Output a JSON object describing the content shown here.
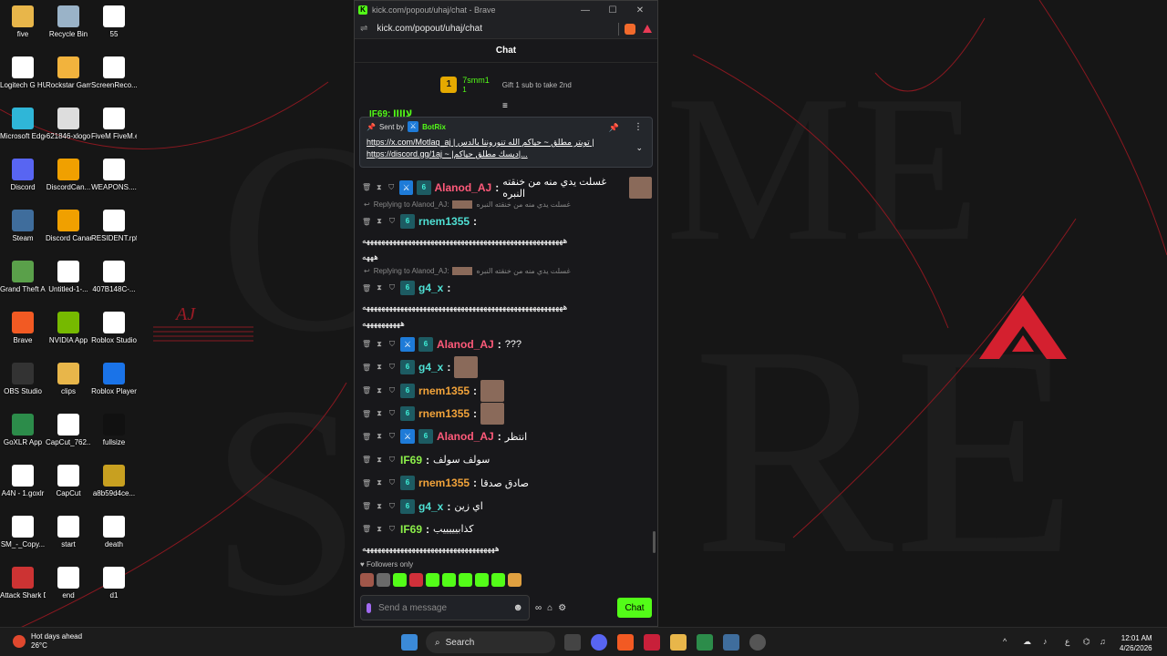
{
  "desktop": {
    "icons": [
      {
        "label": "five",
        "color": "#e8b64a",
        "glyph": "folder-icon"
      },
      {
        "label": "Recycle Bin",
        "color": "#9ab3c8",
        "glyph": "recycle-bin-icon"
      },
      {
        "label": "55",
        "color": "#ffffff",
        "glyph": "file-icon"
      },
      {
        "label": "Logitech G HUB",
        "color": "#ffffff",
        "glyph": "logitech-icon"
      },
      {
        "label": "Rockstar Games ...",
        "color": "#f2b33d",
        "glyph": "rockstar-icon"
      },
      {
        "label": "ScreenReco... ١٦-٣٥-٣٤_١",
        "color": "#ffffff",
        "glyph": "file-icon"
      },
      {
        "label": "Microsoft Edge",
        "color": "#2fb6d8",
        "glyph": "edge-icon"
      },
      {
        "label": "621846-xlogo",
        "color": "#dddddd",
        "glyph": "x-logo-icon"
      },
      {
        "label": "FiveM FiveM.exe ...",
        "color": "#ffffff",
        "glyph": "fivem-icon"
      },
      {
        "label": "Discord",
        "color": "#5865f2",
        "glyph": "discord-icon"
      },
      {
        "label": "DiscordCan...",
        "color": "#f0a000",
        "glyph": "discord-canary-icon"
      },
      {
        "label": "WEAPONS....",
        "color": "#ffffff",
        "glyph": "file-icon"
      },
      {
        "label": "Steam",
        "color": "#3f6d9c",
        "glyph": "steam-icon"
      },
      {
        "label": "Discord Canary",
        "color": "#f0a000",
        "glyph": "discord-canary-icon"
      },
      {
        "label": "RESIDENT.rpf",
        "color": "#ffffff",
        "glyph": "file-icon"
      },
      {
        "label": "Grand Theft Auto V Le...",
        "color": "#5aa04a",
        "glyph": "gta-icon"
      },
      {
        "label": "Untitled-1-...",
        "color": "#ffffff",
        "glyph": "file-icon"
      },
      {
        "label": "407B148C-...",
        "color": "#ffffff",
        "glyph": "file-icon"
      },
      {
        "label": "Brave",
        "color": "#f25a23",
        "glyph": "brave-icon"
      },
      {
        "label": "NVIDIA App",
        "color": "#76b900",
        "glyph": "nvidia-icon"
      },
      {
        "label": "Roblox Studio",
        "color": "#ffffff",
        "glyph": "roblox-studio-icon"
      },
      {
        "label": "OBS Studio",
        "color": "#333333",
        "glyph": "obs-icon"
      },
      {
        "label": "clips",
        "color": "#e8b64a",
        "glyph": "folder-icon"
      },
      {
        "label": "Roblox Player",
        "color": "#1a73e8",
        "glyph": "roblox-icon"
      },
      {
        "label": "GoXLR App",
        "color": "#2c8c4a",
        "glyph": "goxlr-icon"
      },
      {
        "label": "CapCut_762...",
        "color": "#ffffff",
        "glyph": "capcut-icon"
      },
      {
        "label": "fullsize",
        "color": "#111111",
        "glyph": "image-icon"
      },
      {
        "label": "A4N - 1.goxlr",
        "color": "#ffffff",
        "glyph": "file-icon"
      },
      {
        "label": "CapCut",
        "color": "#ffffff",
        "glyph": "capcut-icon"
      },
      {
        "label": "a8b59d4ce...",
        "color": "#c8a020",
        "glyph": "image-icon"
      },
      {
        "label": "SM_-_Copy...",
        "color": "#ffffff",
        "glyph": "file-icon"
      },
      {
        "label": "start",
        "color": "#ffffff",
        "glyph": "file-icon"
      },
      {
        "label": "death",
        "color": "#ffffff",
        "glyph": "file-icon"
      },
      {
        "label": "Attack Shark Driver v4",
        "color": "#cc3333",
        "glyph": "attack-shark-icon"
      },
      {
        "label": "end",
        "color": "#ffffff",
        "glyph": "file-icon"
      },
      {
        "label": "d1",
        "color": "#ffffff",
        "glyph": "file-icon"
      }
    ],
    "wallpaper_text": "AJ"
  },
  "browser": {
    "title": "kick.com/popout/uhaj/chat - Brave",
    "url": "kick.com/popout/uhaj/chat",
    "window_buttons": [
      "—",
      "☐",
      "✕"
    ]
  },
  "chat": {
    "header": "Chat",
    "top_gifter": {
      "rank": "1",
      "name": "7smm1",
      "count": "1",
      "info": "Gift 1 sub to take 2nd"
    },
    "partial_row": "IF69: لااااا",
    "pinned": {
      "sent_by_label": "Sent by",
      "bot": "BotRix",
      "line1": "https://x.com/Motlaq_aj | تويتر مطلق ~ حياكم الله تنوروننا بالدس |",
      "line2": "https://discord.gg/1aj ~ |ديسك مطلق حياكم|..."
    },
    "messages": [
      {
        "type": "msg",
        "user": "Alanod_AJ",
        "color": "#ff5a7a",
        "mod": true,
        "text": "غسلت يدي منه من خنقته النبره",
        "emote": true
      },
      {
        "type": "reply",
        "text": "Replying to Alanod_AJ:",
        "quote": "غسلت يدي منه من خنقته النبره"
      },
      {
        "type": "msg",
        "user": "rnem1355",
        "color": "#4fe0d4",
        "mod": false,
        "text": "",
        "emote": false
      },
      {
        "type": "wrap",
        "text": "هههههههههههههههههههههههههههههههههههههههههههههههههههههه"
      },
      {
        "type": "wrap",
        "text": "هههه"
      },
      {
        "type": "reply",
        "text": "Replying to Alanod_AJ:",
        "quote": "غسلت يدي منه من خنقته النبره"
      },
      {
        "type": "msg",
        "user": "g4_x",
        "color": "#4fe0d4",
        "mod": false,
        "text": "",
        "emote": false
      },
      {
        "type": "wrap",
        "text": "هههههههههههههههههههههههههههههههههههههههههههههههههههههه"
      },
      {
        "type": "wrap",
        "text": "ههههههههههه"
      },
      {
        "type": "msg",
        "user": "Alanod_AJ",
        "color": "#ff5a7a",
        "mod": true,
        "text": "???",
        "emote": false
      },
      {
        "type": "msg",
        "user": "g4_x",
        "color": "#4fe0d4",
        "mod": false,
        "text": "",
        "emote": true
      },
      {
        "type": "msg",
        "user": "rnem1355",
        "color": "#f2a33a",
        "mod": false,
        "text": "",
        "emote": true
      },
      {
        "type": "msg",
        "user": "rnem1355",
        "color": "#f2a33a",
        "mod": false,
        "text": "",
        "emote": true
      },
      {
        "type": "msg",
        "user": "Alanod_AJ",
        "color": "#ff5a7a",
        "mod": true,
        "text": "انتظر",
        "emote": false
      },
      {
        "type": "msg",
        "user": "IF69",
        "color": "#8cf04a",
        "mod": false,
        "nobadge": true,
        "text": "سولف سولف",
        "emote": false
      },
      {
        "type": "msg",
        "user": "rnem1355",
        "color": "#f2a33a",
        "mod": false,
        "text": "صادق صدقا",
        "emote": false
      },
      {
        "type": "msg",
        "user": "g4_x",
        "color": "#4fe0d4",
        "mod": false,
        "text": "اي زين",
        "emote": false
      },
      {
        "type": "msg",
        "user": "IF69",
        "color": "#8cf04a",
        "mod": false,
        "nobadge": true,
        "text": "كذابيييييب",
        "emote": false
      },
      {
        "type": "wrap",
        "text": "هههههههههههههههههههههههههههههههههههه"
      }
    ],
    "followers_only": "Followers only",
    "input_placeholder": "Send a message",
    "send_label": "Chat"
  },
  "taskbar": {
    "weather_title": "Hot days ahead",
    "weather_temp": "26°C",
    "search": "Search",
    "lang": "ع",
    "time": "12:01 AM",
    "date": "4/26/2026"
  }
}
